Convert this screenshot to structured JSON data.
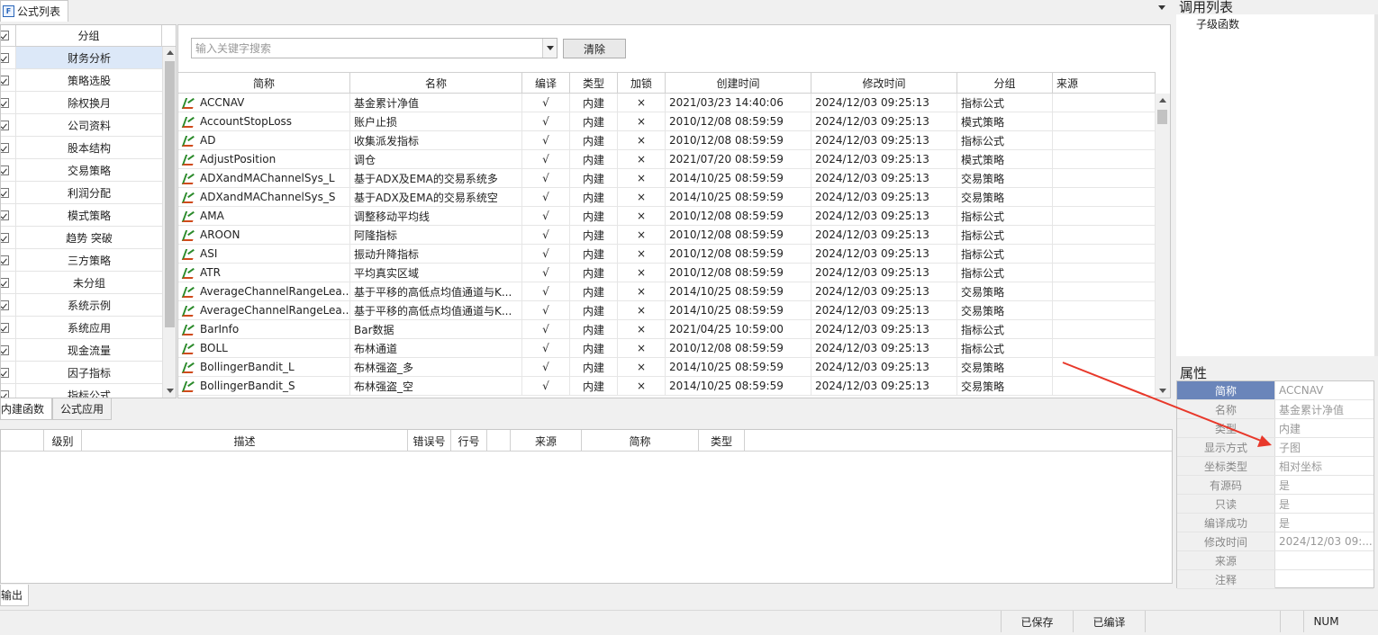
{
  "top_tab": {
    "icon": "formula-list-icon",
    "label": "公式列表"
  },
  "groups": {
    "header": "分组",
    "items": [
      "财务分析",
      "策略选股",
      "除权换月",
      "公司资料",
      "股本结构",
      "交易策略",
      "利润分配",
      "模式策略",
      "趋势 突破",
      "三方策略",
      "未分组",
      "系统示例",
      "系统应用",
      "现金流量",
      "因子指标",
      "指标公式"
    ],
    "selected_index": 0
  },
  "search": {
    "placeholder": "输入关键字搜索",
    "clear_label": "清除"
  },
  "table": {
    "columns": [
      "简称",
      "名称",
      "编译",
      "类型",
      "加锁",
      "创建时间",
      "修改时间",
      "分组",
      "来源"
    ],
    "rows": [
      [
        "ACCNAV",
        "基金累计净值",
        "√",
        "内建",
        "×",
        "2021/03/23 14:40:06",
        "2024/12/03 09:25:13",
        "指标公式",
        ""
      ],
      [
        "AccountStopLoss",
        "账户止损",
        "√",
        "内建",
        "×",
        "2010/12/08 08:59:59",
        "2024/12/03 09:25:13",
        "模式策略",
        ""
      ],
      [
        "AD",
        "收集派发指标",
        "√",
        "内建",
        "×",
        "2010/12/08 08:59:59",
        "2024/12/03 09:25:13",
        "指标公式",
        ""
      ],
      [
        "AdjustPosition",
        "调仓",
        "√",
        "内建",
        "×",
        "2021/07/20 08:59:59",
        "2024/12/03 09:25:13",
        "模式策略",
        ""
      ],
      [
        "ADXandMAChannelSys_L",
        "基于ADX及EMA的交易系统多",
        "√",
        "内建",
        "×",
        "2014/10/25 08:59:59",
        "2024/12/03 09:25:13",
        "交易策略",
        ""
      ],
      [
        "ADXandMAChannelSys_S",
        "基于ADX及EMA的交易系统空",
        "√",
        "内建",
        "×",
        "2014/10/25 08:59:59",
        "2024/12/03 09:25:13",
        "交易策略",
        ""
      ],
      [
        "AMA",
        "调整移动平均线",
        "√",
        "内建",
        "×",
        "2010/12/08 08:59:59",
        "2024/12/03 09:25:13",
        "指标公式",
        ""
      ],
      [
        "AROON",
        "阿隆指标",
        "√",
        "内建",
        "×",
        "2010/12/08 08:59:59",
        "2024/12/03 09:25:13",
        "指标公式",
        ""
      ],
      [
        "ASI",
        "振动升降指标",
        "√",
        "内建",
        "×",
        "2010/12/08 08:59:59",
        "2024/12/03 09:25:13",
        "指标公式",
        ""
      ],
      [
        "ATR",
        "平均真实区域",
        "√",
        "内建",
        "×",
        "2010/12/08 08:59:59",
        "2024/12/03 09:25:13",
        "指标公式",
        ""
      ],
      [
        "AverageChannelRangeLea...",
        "基于平移的高低点均值通道与K...",
        "√",
        "内建",
        "×",
        "2014/10/25 08:59:59",
        "2024/12/03 09:25:13",
        "交易策略",
        ""
      ],
      [
        "AverageChannelRangeLea...",
        "基于平移的高低点均值通道与K...",
        "√",
        "内建",
        "×",
        "2014/10/25 08:59:59",
        "2024/12/03 09:25:13",
        "交易策略",
        ""
      ],
      [
        "BarInfo",
        "Bar数据",
        "√",
        "内建",
        "×",
        "2021/04/25 10:59:00",
        "2024/12/03 09:25:13",
        "指标公式",
        ""
      ],
      [
        "BOLL",
        "布林通道",
        "√",
        "内建",
        "×",
        "2010/12/08 08:59:59",
        "2024/12/03 09:25:13",
        "指标公式",
        ""
      ],
      [
        "BollingerBandit_L",
        "布林强盗_多",
        "√",
        "内建",
        "×",
        "2014/10/25 08:59:59",
        "2024/12/03 09:25:13",
        "交易策略",
        ""
      ],
      [
        "BollingerBandit_S",
        "布林强盗_空",
        "√",
        "内建",
        "×",
        "2014/10/25 08:59:59",
        "2024/12/03 09:25:13",
        "交易策略",
        ""
      ]
    ]
  },
  "bottom_tabs": [
    {
      "label": "内建函数"
    },
    {
      "label": "公式应用"
    }
  ],
  "error_columns": [
    "级别",
    "描述",
    "错误号",
    "行号",
    "来源",
    "简称",
    "类型"
  ],
  "output_tab": "输出",
  "status": {
    "saved": "已保存",
    "compiled": "已编译",
    "num": "NUM"
  },
  "call_list": {
    "title": "调用列表",
    "items": [
      "子级函数"
    ]
  },
  "properties": {
    "title": "属性",
    "rows": [
      {
        "key": "简称",
        "value": "ACCNAV"
      },
      {
        "key": "名称",
        "value": "基金累计净值"
      },
      {
        "key": "类型",
        "value": "内建"
      },
      {
        "key": "显示方式",
        "value": "子图"
      },
      {
        "key": "坐标类型",
        "value": "相对坐标"
      },
      {
        "key": "有源码",
        "value": "是"
      },
      {
        "key": "只读",
        "value": "是"
      },
      {
        "key": "编译成功",
        "value": "是"
      },
      {
        "key": "修改时间",
        "value": "2024/12/03 09:..."
      },
      {
        "key": "来源",
        "value": ""
      },
      {
        "key": "注释",
        "value": ""
      }
    ]
  },
  "colors": {
    "selected_row": "#dce8f8",
    "prop_selected": "#6a85ba",
    "annotation": "#e8382a"
  }
}
